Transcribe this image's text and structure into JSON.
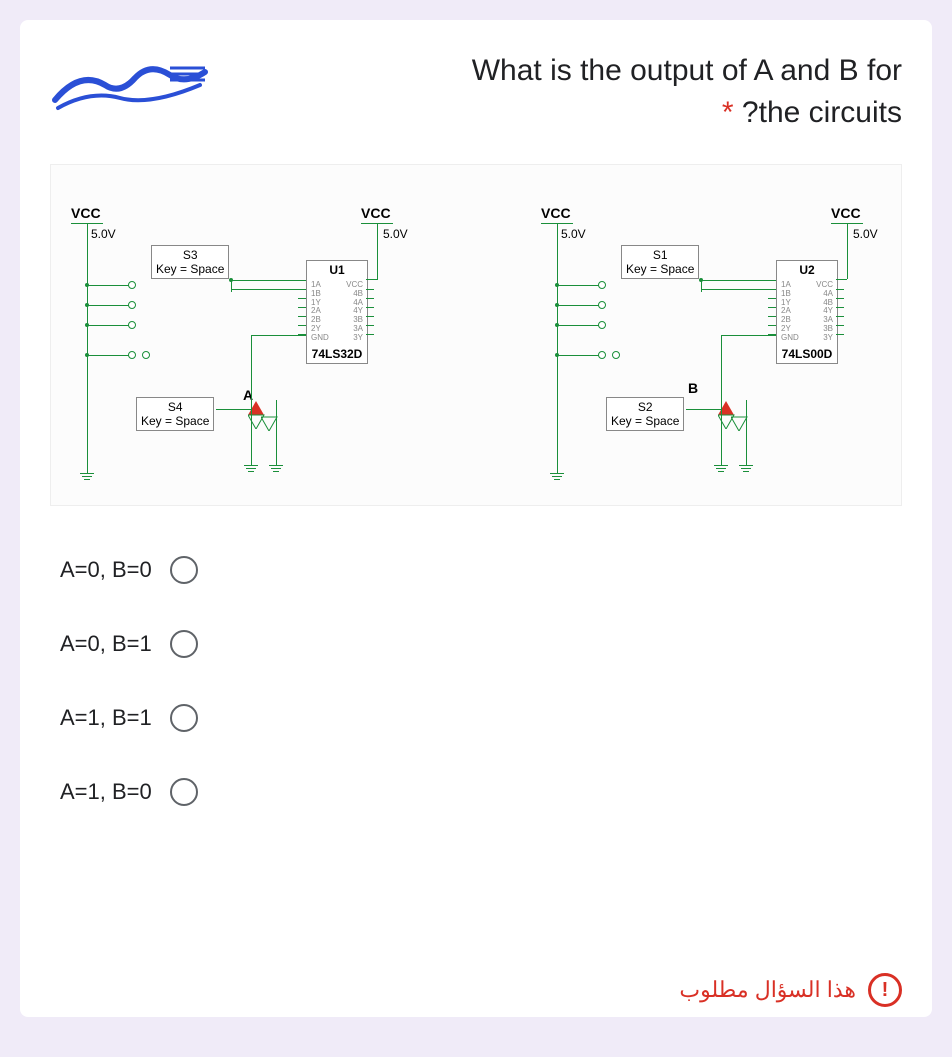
{
  "question": {
    "line1": "What is the output of A and B for",
    "line2_suffix": "the circuits",
    "line2_prefix": "?",
    "asterisk": "*"
  },
  "circuit": {
    "vcc": "VCC",
    "volt": "5.0V",
    "switches": {
      "s1": {
        "name": "S1",
        "key": "Key = Space"
      },
      "s2": {
        "name": "S2",
        "key": "Key = Space"
      },
      "s3": {
        "name": "S3",
        "key": "Key = Space"
      },
      "s4": {
        "name": "S4",
        "key": "Key = Space"
      }
    },
    "chips": {
      "u1": {
        "name": "U1",
        "part": "74LS32D",
        "pins_left": [
          "1A",
          "1B",
          "1Y",
          "2A",
          "2B",
          "2Y",
          "GND"
        ],
        "pins_right": [
          "VCC",
          "4B",
          "4A",
          "4Y",
          "3B",
          "3A",
          "3Y"
        ]
      },
      "u2": {
        "name": "U2",
        "part": "74LS00D",
        "pins_left": [
          "1A",
          "1B",
          "1Y",
          "2A",
          "2B",
          "2Y",
          "GND"
        ],
        "pins_right": [
          "VCC",
          "4A",
          "4B",
          "4Y",
          "3A",
          "3B",
          "3Y"
        ]
      }
    },
    "nets": {
      "A": "A",
      "B": "B"
    }
  },
  "options": [
    "A=0, B=0",
    "A=0, B=1",
    "A=1, B=1",
    "A=1, B=0"
  ],
  "footer": "هذا السؤال مطلوب"
}
